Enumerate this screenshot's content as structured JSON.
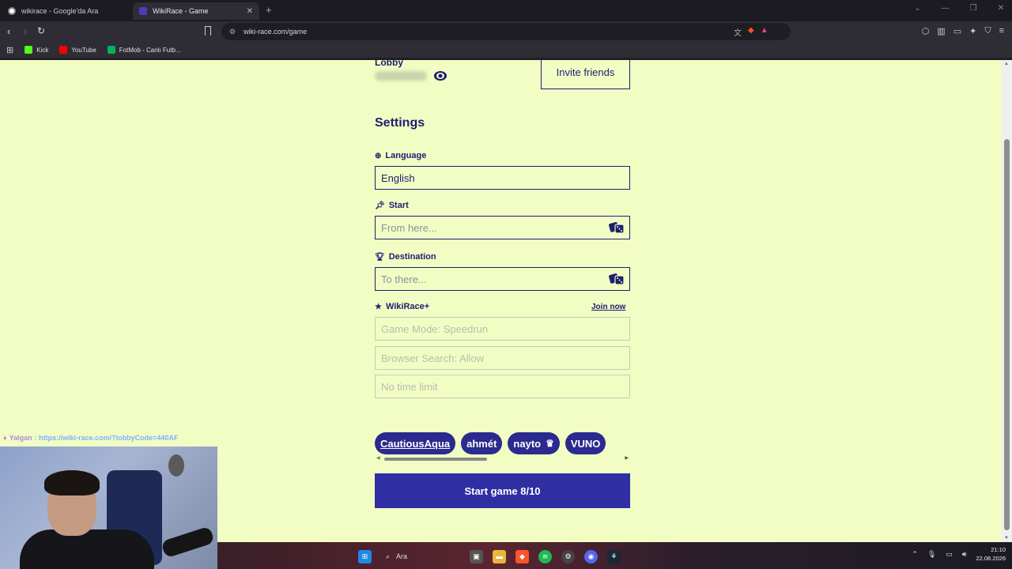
{
  "browser": {
    "tabs": [
      {
        "title": "wikirace - Google'da Ara",
        "active": false
      },
      {
        "title": "WikiRace - Game",
        "active": true
      }
    ],
    "url": "wiki-race.com/game",
    "bookmarks": [
      {
        "label": "Kick",
        "color": "#53fc18"
      },
      {
        "label": "YouTube",
        "color": "#ff0000"
      },
      {
        "label": "FotMob - Canlı Futb...",
        "color": "#00b35a"
      }
    ]
  },
  "lobby": {
    "title": "Lobby",
    "invite_label": "Invite friends"
  },
  "settings": {
    "title": "Settings",
    "language_label": "Language",
    "language_value": "English",
    "start_label": "Start",
    "start_placeholder": "From here...",
    "destination_label": "Destination",
    "destination_placeholder": "To there...",
    "plus_label": "WikiRace+",
    "join_now": "Join now",
    "game_mode": "Game Mode: Speedrun",
    "browser_search": "Browser Search: Allow",
    "time_limit": "No time limit"
  },
  "players": [
    "CautiousAqua",
    "ahmét",
    "nayto",
    "VUNO"
  ],
  "start_button": "Start game 8/10",
  "stream_overlay": {
    "user": "Yalgan",
    "link": ": https://wiki-race.com/?lobbyCode=440AF"
  },
  "taskbar": {
    "search_label": "Ara",
    "time": "21:10",
    "date": "22.08.2026"
  },
  "colors": {
    "page_bg": "#f2fdc4",
    "navy": "#1e1e70",
    "start_button": "#2f2fa3",
    "chip": "#2a2a8f"
  }
}
